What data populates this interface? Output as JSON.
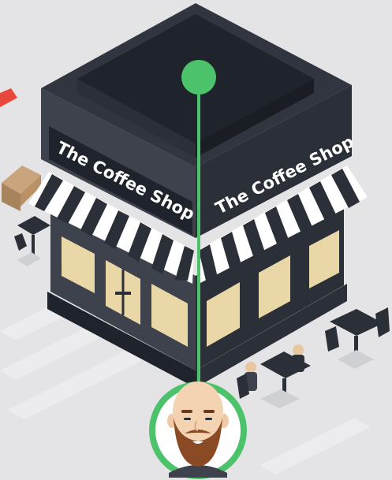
{
  "shop": {
    "sign_left": "The Coffee Shop",
    "sign_right": "The Coffee Shop"
  },
  "marker": {
    "icon": "location-pin-icon",
    "avatar": "bearded-man-avatar"
  },
  "colors": {
    "background": "#e4e4e6",
    "building_dark": "#2b2f38",
    "building_mid": "#3d424c",
    "roof_top": "#1f232b",
    "awning_stripe": "#ffffff",
    "window": "#ead7a8",
    "marker_green": "#4cc36a",
    "accent_red": "#e8473b"
  }
}
